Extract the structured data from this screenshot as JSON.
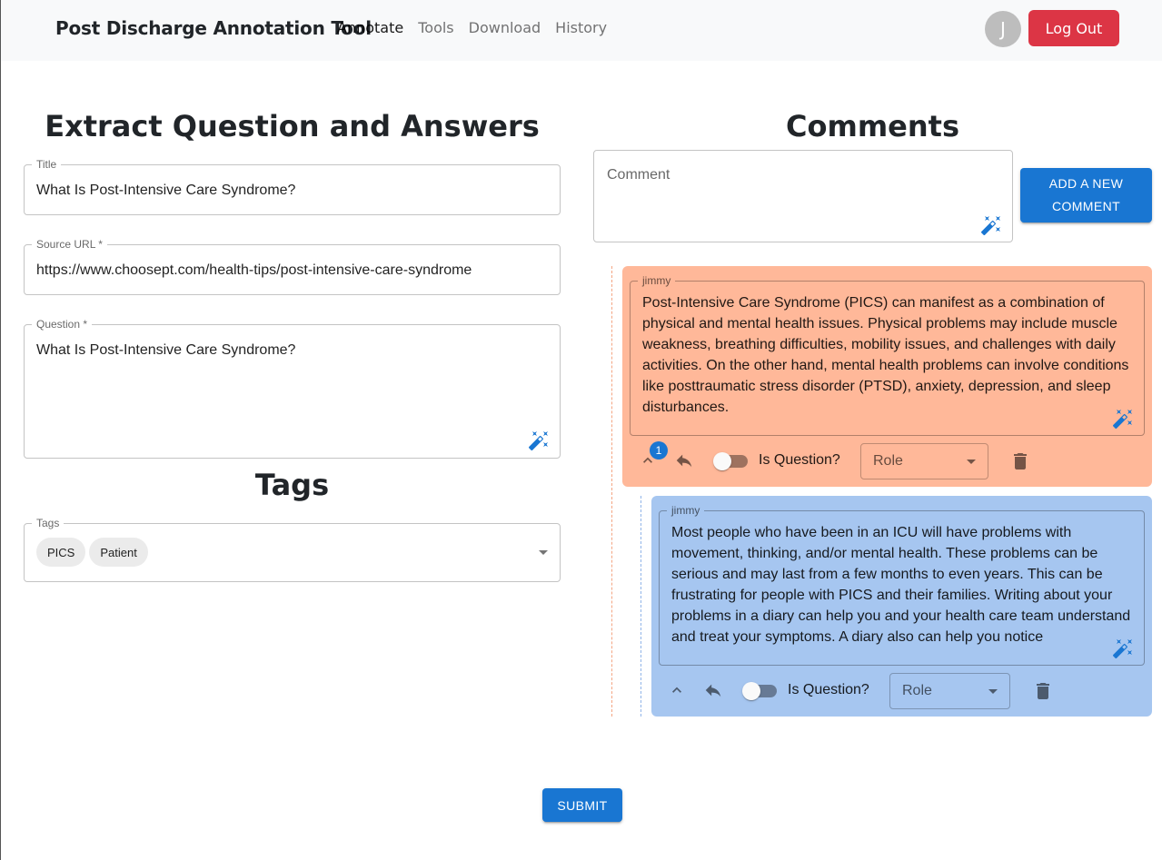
{
  "navbar": {
    "brand": "Post Discharge Annotation Tool",
    "links": [
      "Annotate",
      "Tools",
      "Download",
      "History"
    ],
    "avatar_initial": "J",
    "logout_label": "Log Out"
  },
  "extract": {
    "heading": "Extract Question and Answers",
    "title_label": "Title",
    "title_value": "What Is Post-Intensive Care Syndrome?",
    "source_label": "Source URL *",
    "source_value": "https://www.choosept.com/health-tips/post-intensive-care-syndrome",
    "question_label": "Question *",
    "question_value": "What Is Post-Intensive Care Syndrome?"
  },
  "tags": {
    "heading": "Tags",
    "label": "Tags",
    "chips": [
      "PICS",
      "Patient"
    ]
  },
  "comments": {
    "heading": "Comments",
    "placeholder": "Comment",
    "add_button_line1": "ADD A NEW",
    "add_button_line2": "COMMENT",
    "items": [
      {
        "author": "jimmy",
        "text": "Post-Intensive Care Syndrome (PICS) can manifest as a combination of physical and mental health issues. Physical problems may include muscle weakness, breathing difficulties, mobility issues, and challenges with daily activities. On the other hand, mental health problems can involve conditions like posttraumatic stress disorder (PTSD), anxiety, depression, and sleep disturbances.",
        "reply_count": "1",
        "is_question_label": "Is Question?",
        "role_label": "Role"
      },
      {
        "author": "jimmy",
        "text": "Most people who have been in an ICU will have problems with movement, thinking, and/or mental health. These problems can be serious and may last from a few months to even years. This can be frustrating for people with PICS and their families. Writing about your problems in a diary can help you and your health care team understand and treat your symptoms. A diary also can help you notice",
        "is_question_label": "Is Question?",
        "role_label": "Role"
      }
    ]
  },
  "submit_label": "SUBMIT",
  "colors": {
    "primary": "#1976d2",
    "danger": "#dc3545",
    "comment1_bg": "#ffb899",
    "comment2_bg": "#a6c6f0"
  }
}
